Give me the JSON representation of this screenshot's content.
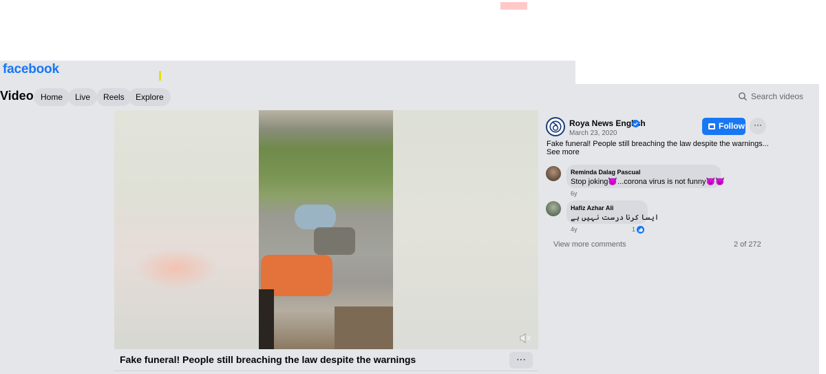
{
  "brand": {
    "logo_text": "facebook",
    "accent_color": "#1877f2"
  },
  "header": {
    "section_title": "Video",
    "nav": [
      "Home",
      "Live",
      "Reels",
      "Explore"
    ],
    "search_placeholder": "Search videos"
  },
  "video": {
    "title": "Fake funeral! People still breaching the law despite the warnings",
    "more_label": "···",
    "muted": true
  },
  "post": {
    "page_name": "Roya News English",
    "verified": true,
    "date": "March 23, 2020",
    "follow_label": "Follow",
    "more_label": "···",
    "text": "Fake funeral! People still breaching the law despite the warnings...",
    "see_more_label": "See more"
  },
  "comments": [
    {
      "author": "Reminda Dalag Pascual",
      "text": "Stop joking😈...corona virus is not funny😈😈",
      "age": "6y"
    },
    {
      "author": "Hafiz Azhar Ali",
      "text": "ایسا کرنا درست نہیں ہے",
      "age": "4y",
      "likes": "1"
    }
  ],
  "comments_footer": {
    "view_more_label": "View more comments",
    "count_label": "2 of 272"
  }
}
